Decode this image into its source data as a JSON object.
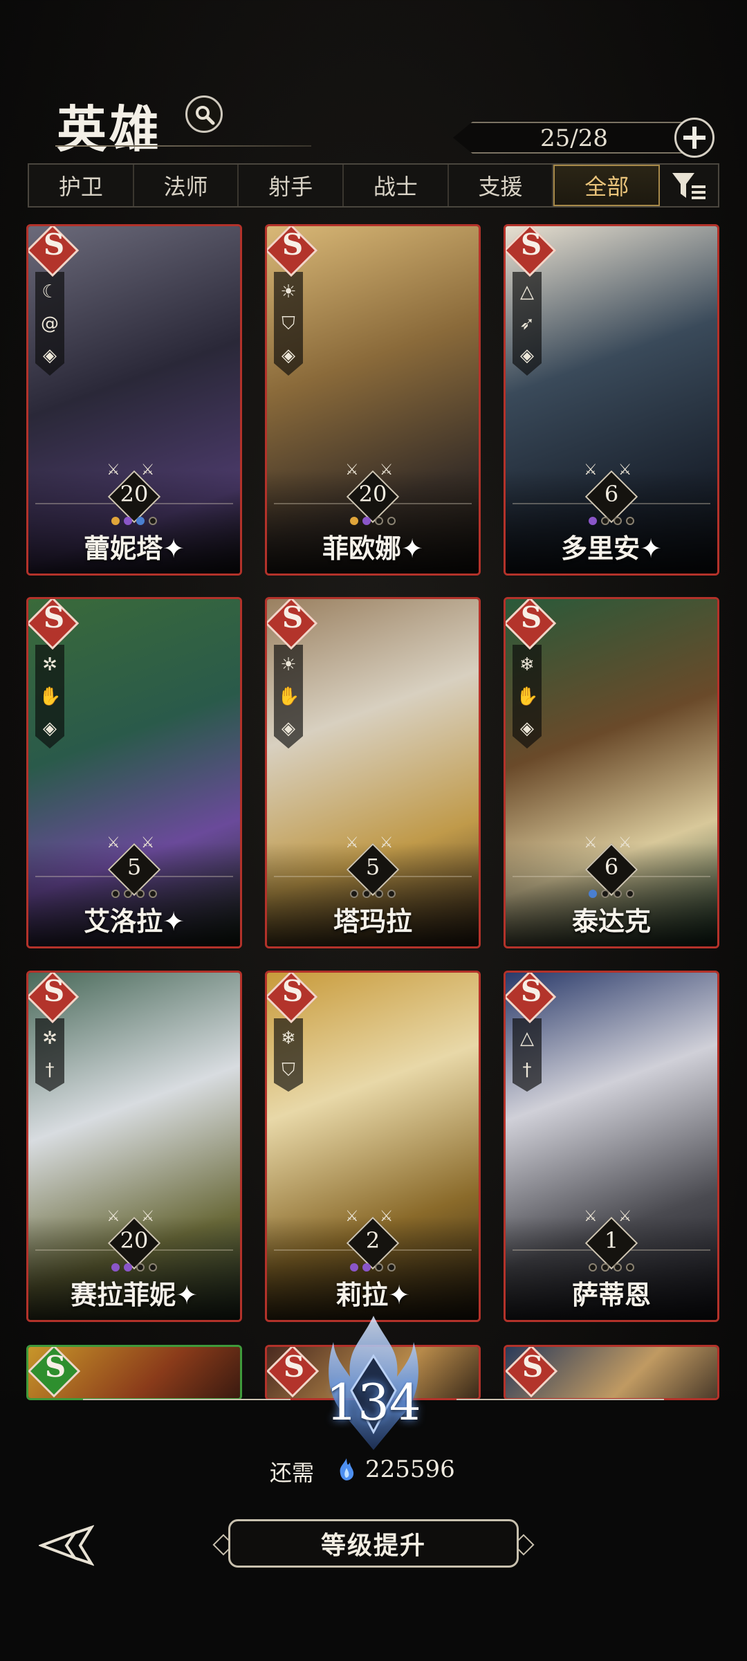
{
  "header": {
    "title": "英雄",
    "count": "25/28"
  },
  "tabs": [
    {
      "label": "护卫",
      "active": false
    },
    {
      "label": "法师",
      "active": false
    },
    {
      "label": "射手",
      "active": false
    },
    {
      "label": "战士",
      "active": false
    },
    {
      "label": "支援",
      "active": false
    },
    {
      "label": "全部",
      "active": true
    }
  ],
  "heroes": [
    {
      "name": "蕾妮塔",
      "rank": "S",
      "level": "20",
      "star": "✦",
      "icons": [
        "bat-icon",
        "spiral-icon",
        "dragon-icon"
      ]
    },
    {
      "name": "菲欧娜",
      "rank": "S",
      "level": "20",
      "star": "✦",
      "icons": [
        "sun-icon",
        "shield-icon",
        "dragon-icon"
      ]
    },
    {
      "name": "多里安",
      "rank": "S",
      "level": "6",
      "star": "✦",
      "icons": [
        "triangle-icon",
        "bow-icon",
        "dragon-icon"
      ]
    },
    {
      "name": "艾洛拉",
      "rank": "S",
      "level": "5",
      "star": "✦",
      "icons": [
        "tree-icon",
        "hand-icon",
        "dragon-icon"
      ]
    },
    {
      "name": "塔玛拉",
      "rank": "S",
      "level": "5",
      "star": "",
      "icons": [
        "sun-icon",
        "hand-icon",
        "dragon-icon"
      ]
    },
    {
      "name": "泰达克",
      "rank": "S",
      "level": "6",
      "star": "",
      "icons": [
        "snowflake-icon",
        "hand-icon",
        "dragon-icon"
      ]
    },
    {
      "name": "赛拉菲妮",
      "rank": "S",
      "level": "20",
      "star": "✦",
      "icons": [
        "tree-icon",
        "dagger-icon"
      ]
    },
    {
      "name": "莉拉",
      "rank": "S",
      "level": "2",
      "star": "✦",
      "icons": [
        "snowflake-icon",
        "shield-icon"
      ]
    },
    {
      "name": "萨蒂恩",
      "rank": "S",
      "level": "1",
      "star": "",
      "icons": [
        "triangle-icon",
        "dagger-icon"
      ]
    }
  ],
  "partial_cards": [
    {
      "rank": "S"
    },
    {
      "rank": "S"
    },
    {
      "rank": "S"
    }
  ],
  "account": {
    "level": "134",
    "need_label": "还需",
    "need_value": "225596"
  },
  "upgrade_label": "等级提升",
  "colors": {
    "rank_red": "#b3342b",
    "rank_green": "#2e8f2e",
    "active_tab": "#e9c37a"
  }
}
